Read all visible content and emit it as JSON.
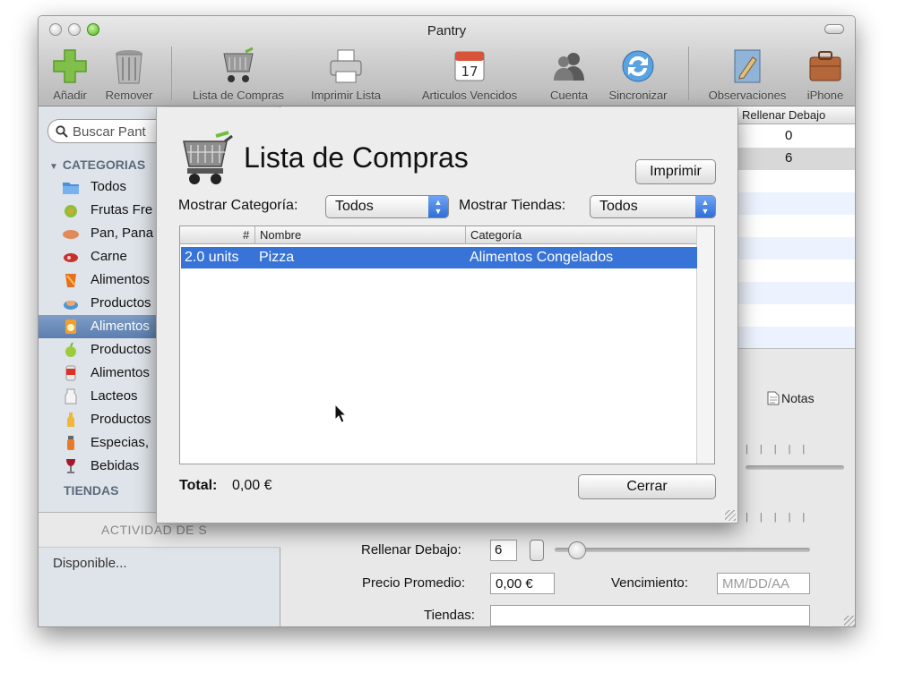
{
  "window": {
    "title": "Pantry"
  },
  "toolbar": {
    "add": "Añadir",
    "remove": "Remover",
    "shopping_list": "Lista de Compras",
    "print_list": "Imprimir Lista",
    "expired": "Articulos Vencidos",
    "account": "Cuenta",
    "sync": "Sincronizar",
    "observations": "Observaciones",
    "iphone": "iPhone",
    "calendar_day": "17"
  },
  "sidebar": {
    "search_placeholder": "Buscar Pant",
    "categories_header": "CATEGORIAS",
    "categories": [
      {
        "label": "Todos",
        "icon": "folder-icon"
      },
      {
        "label": "Frutas Fre",
        "icon": "fruit-icon"
      },
      {
        "label": "Pan, Pana",
        "icon": "bread-icon"
      },
      {
        "label": "Carne",
        "icon": "meat-icon"
      },
      {
        "label": "Alimentos",
        "icon": "box-icon"
      },
      {
        "label": "Productos",
        "icon": "product-icon"
      },
      {
        "label": "Alimentos",
        "icon": "frozen-icon"
      },
      {
        "label": "Productos",
        "icon": "apple-icon"
      },
      {
        "label": "Alimentos",
        "icon": "can-icon"
      },
      {
        "label": "Lacteos",
        "icon": "milk-icon"
      },
      {
        "label": "Productos",
        "icon": "bottle-icon"
      },
      {
        "label": "Especias,",
        "icon": "spice-icon"
      },
      {
        "label": "Bebidas",
        "icon": "wine-icon"
      }
    ],
    "stores_header": "TIENDAS",
    "activity_header": "ACTIVIDAD DE S",
    "status": "Disponible..."
  },
  "main": {
    "refill_header": "Rellenar Debajo",
    "refill_values": [
      "0",
      "6"
    ],
    "notes_tab": "Notas",
    "refill_label": "Rellenar Debajo:",
    "refill_value": "6",
    "avg_price_label": "Precio Promedio:",
    "avg_price_value": "0,00 €",
    "expiry_label": "Vencimiento:",
    "expiry_placeholder": "MM/DD/AA",
    "stores_label": "Tiendas:"
  },
  "sheet": {
    "title": "Lista de Compras",
    "print_button": "Imprimir",
    "category_label": "Mostrar Categoría:",
    "category_value": "Todos",
    "stores_label": "Mostrar Tiendas:",
    "stores_value": "Todos",
    "columns": [
      "#",
      "Nombre",
      "Categoría"
    ],
    "rows": [
      {
        "qty": "2.0 units",
        "name": "Pizza",
        "category": "Alimentos Congelados"
      }
    ],
    "total_label": "Total:",
    "total_value": "0,00 €",
    "close_button": "Cerrar"
  },
  "colors": {
    "selection": "#3874d7",
    "sidebar_selection": "#5c7fb0",
    "popup_arrows": "#2f6ed7"
  }
}
